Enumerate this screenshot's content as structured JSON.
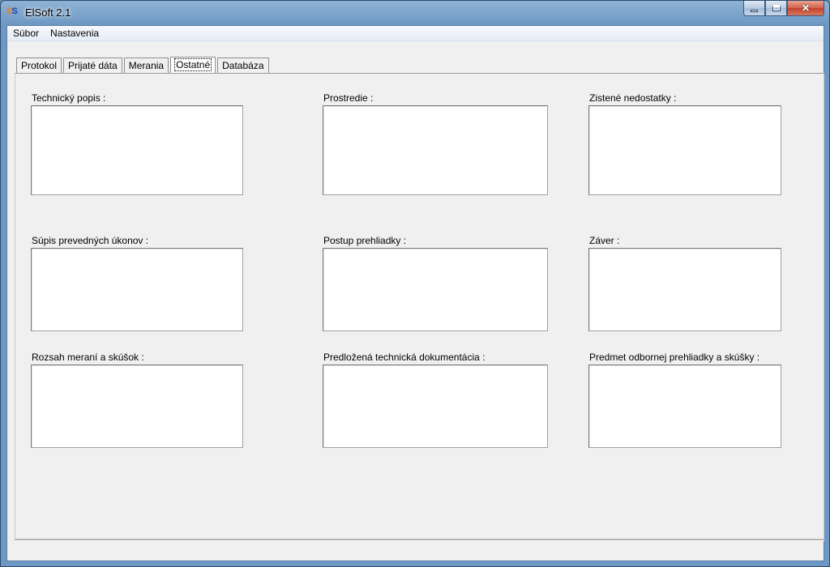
{
  "window": {
    "title": "ElSoft 2.1",
    "app_icon_e": "E",
    "app_icon_s": "S"
  },
  "menu": [
    "Súbor",
    "Nastavenia"
  ],
  "tabs": [
    {
      "label": "Protokol",
      "active": false
    },
    {
      "label": "Prijaté dáta",
      "active": false
    },
    {
      "label": "Merania",
      "active": false
    },
    {
      "label": "Ostatné",
      "active": true
    },
    {
      "label": "Databáza",
      "active": false
    }
  ],
  "fields": {
    "technicky_popis": "Technický popis :",
    "prostredie": "Prostredie :",
    "zistene_nedostatky": "Zistené nedostatky :",
    "supis_prevednych_ukonov": "Súpis prevedných úkonov :",
    "postup_prehliadky": "Postup prehliadky :",
    "zaver": "Záver :",
    "rozsah_merani": "Rozsah meraní a skúšok :",
    "predlozena_dokumentacia": "Predložená technická dokumentácia :",
    "predmet_prehliadky": "Predmet odbornej prehliadky a skúšky :"
  }
}
